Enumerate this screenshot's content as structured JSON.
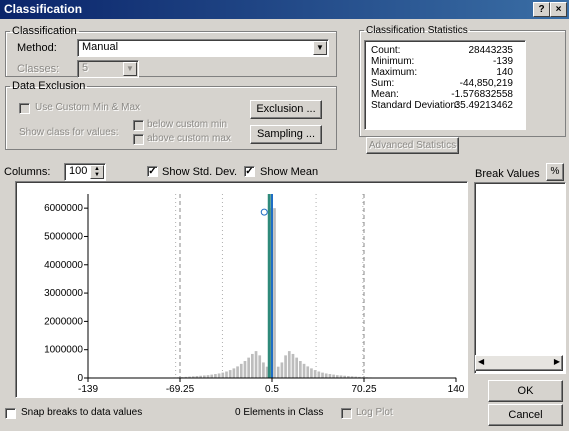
{
  "window": {
    "title": "Classification",
    "help_label": "?",
    "close_label": "×"
  },
  "classification": {
    "group_label": "Classification",
    "method_label": "Method:",
    "method_value": "Manual",
    "classes_label": "Classes:",
    "classes_value": "5"
  },
  "data_exclusion": {
    "group_label": "Data Exclusion",
    "use_custom_label": "Use Custom Min & Max",
    "show_class_label": "Show class for values:",
    "below_custom_label": "below custom min",
    "above_custom_label": "above custom max",
    "exclusion_button": "Exclusion ...",
    "sampling_button": "Sampling ..."
  },
  "statistics": {
    "group_label": "Classification Statistics",
    "rows": [
      {
        "key": "Count:",
        "value": "28443235"
      },
      {
        "key": "Minimum:",
        "value": "-139"
      },
      {
        "key": "Maximum:",
        "value": "140"
      },
      {
        "key": "Sum:",
        "value": "-44,850,219"
      },
      {
        "key": "Mean:",
        "value": "-1.576832558"
      },
      {
        "key": "Standard Deviation:",
        "value": "35.49213462"
      }
    ],
    "advanced_button": "Advanced Statistics"
  },
  "histogram_controls": {
    "columns_label": "Columns:",
    "columns_value": "100",
    "show_std_dev_label": "Show Std. Dev.",
    "show_std_dev_checked": true,
    "show_mean_label": "Show Mean",
    "show_mean_checked": true
  },
  "break_values": {
    "label": "Break Values",
    "sort_icon": "percent-sort-icon"
  },
  "bottom": {
    "snap_label": "Snap breaks to data values",
    "elements_text": "0 Elements in Class",
    "log_plot_label": "Log Plot",
    "ok_button": "OK",
    "cancel_button": "Cancel"
  },
  "colors": {
    "titlebar": "#0a246a",
    "bar": "#bdbdbd",
    "mean_line": "#1f6dc4",
    "std_line": "#2f8a7a",
    "break_line": "#8a8a8a"
  },
  "chart_data": {
    "type": "bar",
    "title": "",
    "xlabel": "",
    "ylabel": "",
    "ylim": [
      0,
      6500000
    ],
    "xlim": [
      -139,
      140
    ],
    "yticks": [
      {
        "value": 0,
        "label": "0"
      },
      {
        "value": 1000000,
        "label": "1000000"
      },
      {
        "value": 2000000,
        "label": "2000000"
      },
      {
        "value": 3000000,
        "label": "3000000"
      },
      {
        "value": 4000000,
        "label": "4000000"
      },
      {
        "value": 5000000,
        "label": "5000000"
      },
      {
        "value": 6000000,
        "label": "6000000"
      }
    ],
    "xticks": [
      {
        "value": -139,
        "label": "-139"
      },
      {
        "value": -69.25,
        "label": "-69.25"
      },
      {
        "value": 0.5,
        "label": "0.5"
      },
      {
        "value": 70.25,
        "label": "70.25"
      },
      {
        "value": 140,
        "label": "140"
      }
    ],
    "bin_centers": [
      -137.6,
      -134.8,
      -132.0,
      -129.2,
      -126.4,
      -123.6,
      -120.8,
      -118.0,
      -115.2,
      -112.4,
      -109.6,
      -106.8,
      -104.0,
      -101.2,
      -98.4,
      -95.6,
      -92.8,
      -90.0,
      -87.2,
      -84.4,
      -81.6,
      -78.8,
      -76.0,
      -73.2,
      -70.4,
      -67.6,
      -64.8,
      -62.0,
      -59.2,
      -56.4,
      -53.6,
      -50.8,
      -48.0,
      -45.2,
      -42.4,
      -39.6,
      -36.8,
      -34.0,
      -31.2,
      -28.4,
      -25.6,
      -22.8,
      -20.0,
      -17.2,
      -14.4,
      -11.6,
      -8.8,
      -6.0,
      -3.2,
      -0.4,
      2.4,
      5.2,
      8.0,
      10.8,
      13.6,
      16.4,
      19.2,
      22.0,
      24.8,
      27.6,
      30.4,
      33.2,
      36.0,
      38.8,
      41.6,
      44.4,
      47.2,
      50.0,
      52.8,
      55.6,
      58.4,
      61.2,
      64.0,
      66.8,
      69.6,
      72.4,
      75.2,
      78.0,
      80.8,
      83.6,
      86.4,
      89.2,
      92.0,
      94.8,
      97.6,
      100.4,
      103.2,
      106.0,
      108.8,
      111.6,
      114.4,
      117.2,
      120.0,
      122.8,
      125.6,
      128.4,
      131.2,
      134.0,
      136.8,
      139.6
    ],
    "values": [
      20000,
      15000,
      12000,
      10000,
      9000,
      8000,
      8000,
      7000,
      7000,
      6000,
      6000,
      5000,
      5000,
      5000,
      5000,
      5000,
      6000,
      7000,
      8000,
      10000,
      12000,
      14000,
      16000,
      20000,
      25000,
      30000,
      40000,
      50000,
      60000,
      70000,
      80000,
      90000,
      100000,
      120000,
      140000,
      160000,
      190000,
      230000,
      280000,
      340000,
      410000,
      500000,
      600000,
      720000,
      850000,
      950000,
      800000,
      550000,
      400000,
      6000000,
      6000000,
      400000,
      550000,
      800000,
      950000,
      850000,
      720000,
      600000,
      500000,
      410000,
      340000,
      280000,
      230000,
      190000,
      160000,
      140000,
      120000,
      100000,
      90000,
      80000,
      70000,
      60000,
      50000,
      40000,
      30000,
      25000,
      20000,
      16000,
      14000,
      12000,
      10000,
      8000,
      7000,
      6000,
      5000,
      5000,
      5000,
      5000,
      5000,
      6000,
      6000,
      7000,
      7000,
      8000,
      8000,
      9000,
      10000,
      12000,
      15000,
      20000
    ],
    "mean": -1.576832558,
    "std_dev": 35.49213462,
    "break_values": [
      -69.25,
      0.5,
      70.25
    ]
  }
}
